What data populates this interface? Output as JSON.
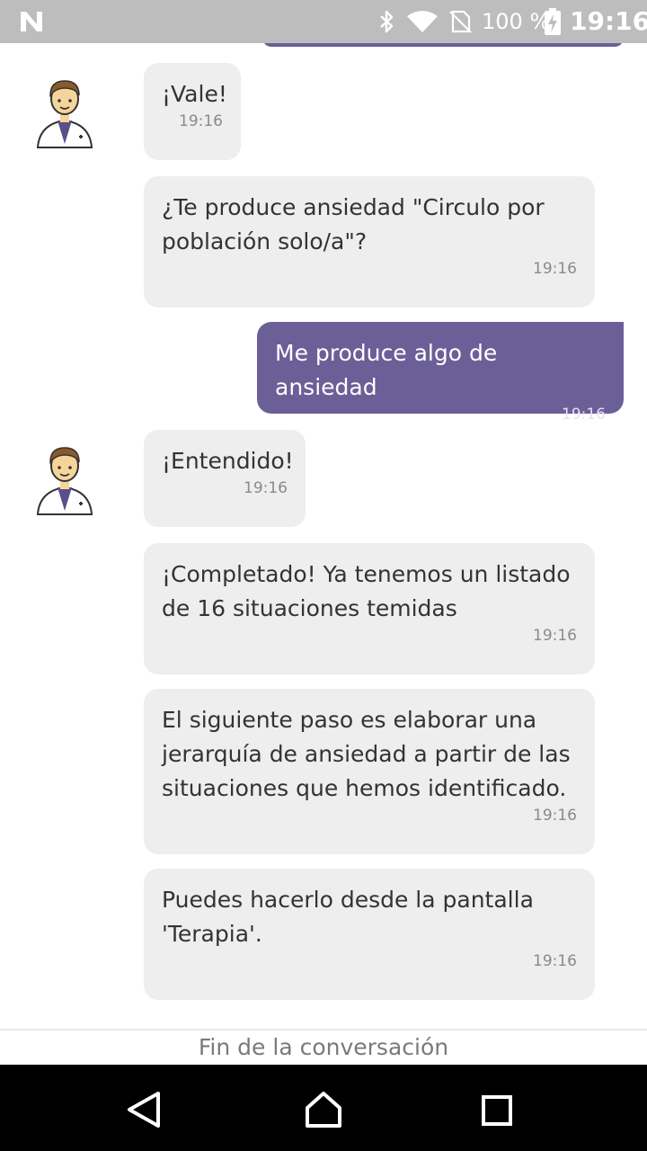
{
  "status_bar": {
    "battery_percent": "100 %",
    "time": "19:16",
    "icons": [
      "notification-n-icon",
      "bluetooth-icon",
      "wifi-icon",
      "no-sim-icon",
      "battery-charging-icon"
    ]
  },
  "chat": {
    "messages": [
      {
        "sender": "bot",
        "text": "¡Vale!",
        "time": "19:16"
      },
      {
        "sender": "bot",
        "text": "¿Te produce ansiedad \"Circulo por\npoblación solo/a\"?",
        "time": "19:16"
      },
      {
        "sender": "user",
        "text": "Me produce algo de ansiedad",
        "time": "19:16"
      },
      {
        "sender": "bot",
        "text": "¡Entendido!",
        "time": "19:16"
      },
      {
        "sender": "bot",
        "text": "¡Completado! Ya tenemos un listado\nde 16 situaciones temidas",
        "time": "19:16"
      },
      {
        "sender": "bot",
        "text": "El siguiente paso es elaborar una\njerarquía de ansiedad a partir de las\nsituaciones que hemos identificado.",
        "time": "19:16"
      },
      {
        "sender": "bot",
        "text": "Puedes hacerlo desde la pantalla\n'Terapia'.",
        "time": "19:16"
      }
    ]
  },
  "footer": {
    "end_label": "Fin de la conversación"
  },
  "colors": {
    "user_bubble": "#6b5f98",
    "bot_bubble": "#eeeeee",
    "status_bar": "#bdbdbd"
  }
}
